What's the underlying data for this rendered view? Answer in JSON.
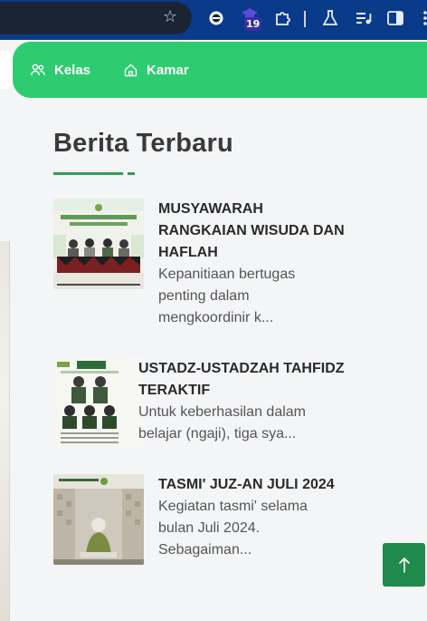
{
  "browser": {
    "extension_badge": "19",
    "icons": [
      "star-icon",
      "circle-ext-icon",
      "mortarboard-ext-icon",
      "puzzle-icon",
      "flask-icon",
      "media-list-icon",
      "side-panel-icon",
      "more-vert-icon"
    ]
  },
  "nav": {
    "items": [
      {
        "label": "Kelas",
        "icon": "users-icon"
      },
      {
        "label": "Kamar",
        "icon": "home-icon"
      }
    ],
    "color": "#2ecc71"
  },
  "section": {
    "title": "Berita Terbaru",
    "accent": "#2e9e55"
  },
  "news": [
    {
      "title": "MUSYAWARAH RANGKAIAN WISUDA DAN HAFLAH",
      "excerpt": "Kepanitiaan bertugas penting dalam mengkoordinir k..."
    },
    {
      "title": "USTADZ-USTADZAH TAHFIDZ TERAKTIF",
      "excerpt": "Untuk keberhasilan dalam belajar (ngaji), tiga sya..."
    },
    {
      "title": "TASMI' JUZ-AN JULI 2024",
      "excerpt": "Kegiatan tasmi' selama bulan Juli 2024. Sebagaiman..."
    }
  ],
  "back_to_top": {
    "icon": "arrow-up-icon",
    "color": "#1f8a4c"
  }
}
